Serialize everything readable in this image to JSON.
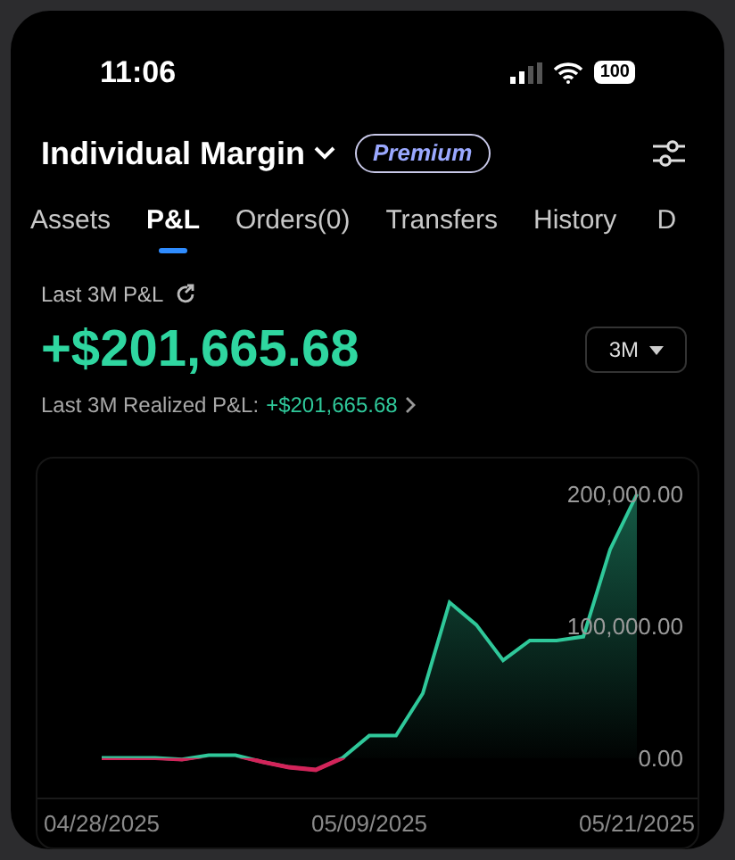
{
  "status_bar": {
    "time": "11:06",
    "battery": "100"
  },
  "header": {
    "account": "Individual Margin",
    "badge": "Premium"
  },
  "tabs": [
    {
      "label": "Assets",
      "selected": false
    },
    {
      "label": "P&L",
      "selected": true
    },
    {
      "label": "Orders(0)",
      "selected": false
    },
    {
      "label": "Transfers",
      "selected": false
    },
    {
      "label": "History",
      "selected": false
    },
    {
      "label": "D",
      "selected": false
    }
  ],
  "pnl": {
    "label": "Last 3M P&L",
    "amount": "+$201,665.68",
    "period": "3M",
    "realized_label": "Last 3M Realized P&L:",
    "realized_value": "+$201,665.68"
  },
  "chart": {
    "chart_data": {
      "type": "area",
      "categories": [
        "04/28/2025",
        null,
        null,
        null,
        null,
        null,
        null,
        null,
        null,
        null,
        "05/09/2025",
        null,
        null,
        null,
        null,
        null,
        null,
        null,
        null,
        null,
        "05/21/2025"
      ],
      "ylim": [
        -30000,
        200000
      ],
      "series": [
        {
          "color": "#2fc89a",
          "values": [
            0,
            0,
            0,
            -1000,
            2000,
            2000,
            -3000,
            -7000,
            -9000,
            0,
            17000,
            17000,
            49000,
            118000,
            101000,
            74000,
            89000,
            89000,
            92000,
            158000,
            200000
          ]
        }
      ],
      "yticks": [
        {
          "value": 0,
          "label": "0.00"
        },
        {
          "value": 100000,
          "label": "100,000.00"
        },
        {
          "value": 200000,
          "label": "200,000.00"
        }
      ]
    }
  }
}
